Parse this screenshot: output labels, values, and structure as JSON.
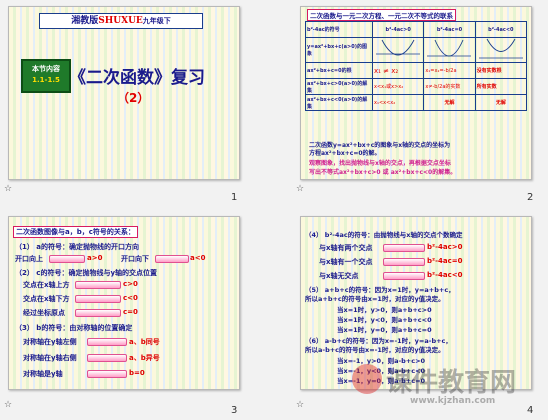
{
  "slides": [
    {
      "number": "1",
      "header_text": "湘教版",
      "header_brand": "SHUXUE",
      "header_grade": "九年级下",
      "badge_line1": "本节内容",
      "badge_line2": "1.1-1.5",
      "title": "《二次函数》复习",
      "subtitle": "（2）"
    },
    {
      "number": "2",
      "heading": "二次函数与一元二次方程、一元二次不等式的联系",
      "col_headers": [
        "b²-4ac的符号",
        "b²-4ac>0",
        "b²-4ac=0",
        "b²-4ac<0"
      ],
      "row_labels": [
        "y=ax²+bx+c(a>0)的图象",
        "ax²+bx+c=0的根",
        "ax²+bx+c>0(a>0)的解集",
        "ax²+bx+c<0(a>0)的解集"
      ],
      "roots": [
        "x₁ ≠ x₂",
        "x₁=x₂=-b/2a",
        "没有实数根"
      ],
      "gt_sets": [
        "x<x₁或x>x₂",
        "x≠-b/2a的实数",
        "所有实数"
      ],
      "lt_sets": [
        "x₁<x<x₂",
        "无解",
        "无解"
      ],
      "note1": "二次函数y=ax²+bx+c的图象与x轴的交点的坐标为",
      "note2": "方程ax²+bx+c=0的解。",
      "note3": "观察图象，找出抛物线与x轴的交点，再根据交点坐标",
      "note4": "写出不等式ax²+bx+c>0 或 ax²+bx+c<0的解集。"
    },
    {
      "number": "3",
      "heading": "二次函数图像与a，b，c符号的关系：",
      "s1": "（1） a的符号：确定抛物线的开口方向",
      "s1a": "开口向上",
      "s1a_r": "a>0",
      "s1b": "开口向下",
      "s1b_r": "a<0",
      "s2": "（2） c的符号：确定抛物线与y轴的交点位置",
      "s2a": "交点在x轴上方",
      "s2a_r": "c>0",
      "s2b": "交点在x轴下方",
      "s2b_r": "c<0",
      "s2c": "经过坐标原点",
      "s2c_r": "c=0",
      "s3": "（3） b的符号：由对称轴的位置确定",
      "s3a": "对称轴在y轴左侧",
      "s3a_r": "a、b同号",
      "s3b": "对称轴在y轴右侧",
      "s3b_r": "a、b异号",
      "s3c": "对称轴是y轴",
      "s3c_r": "b=0"
    },
    {
      "number": "4",
      "s4": "（4） b²-4ac的符号：由抛物线与x轴的交点个数确定",
      "s4a": "与x轴有两个交点",
      "s4a_r": "b²-4ac>0",
      "s4b": "与x轴有一个交点",
      "s4b_r": "b²-4ac=0",
      "s4c": "与x轴无交点",
      "s4c_r": "b²-4ac<0",
      "s5": "（5） a+b+c的符号：因为x=1时，y=a+b+c，",
      "s5b": "所以a+b+c的符号由x=1时，对应的y值决定。",
      "s5c": "当x=1时，y>0，则a+b+c>0",
      "s5d": "当x=1时，y<0，则a+b+c<0",
      "s5e": "当x=1时，y=0，则a+b+c=0",
      "s6": "（6） a-b+c的符号：因为x=-1时，y=a-b+c，",
      "s6b": "所以a-b+c的符号由x=-1时，对应的y值决定。",
      "s6c": "当x=-1，y>0，则a-b+c>0",
      "s6d": "当x=-1，y<0，则a-b+c<0",
      "s6e": "当x=-1，y=0，则a-b+c=0"
    }
  ],
  "watermark": {
    "text": "课件教育网",
    "url": "www.kjzhan.com"
  }
}
